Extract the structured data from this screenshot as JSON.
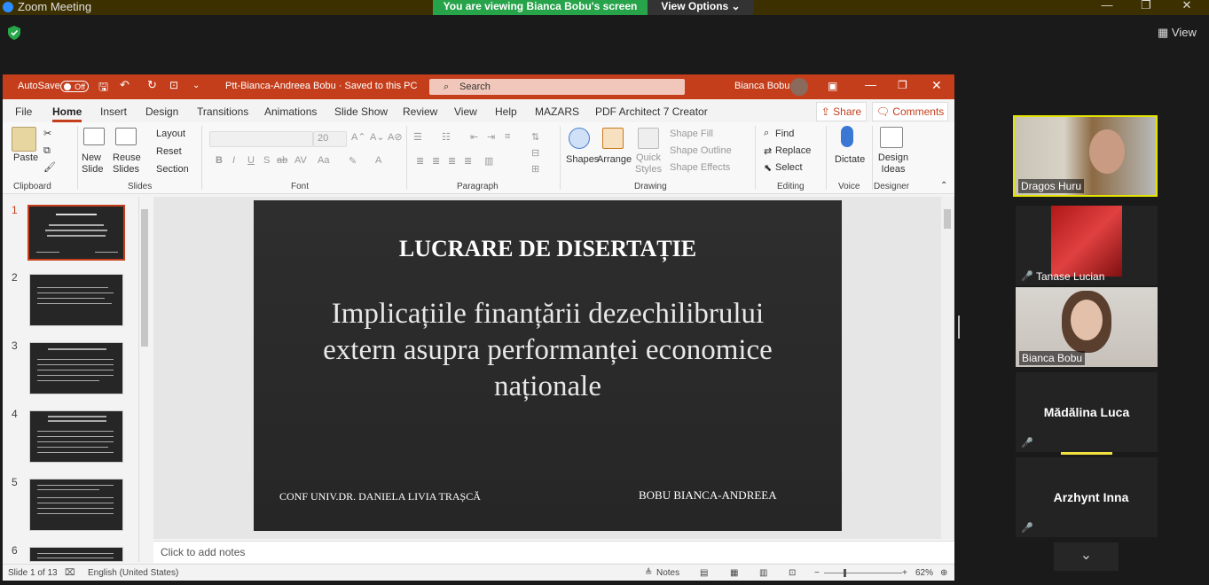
{
  "zoom": {
    "title": "Zoom Meeting",
    "share_banner": "You are viewing Bianca Bobu's screen",
    "view_options": "View Options ⌄",
    "minimize": "—",
    "maximize": "❐",
    "close": "✕",
    "view_label": "View",
    "accent_green": "#27a34a"
  },
  "ppt": {
    "autosave_label": "AutoSave",
    "autosave_state": "Off",
    "filename": "Ptt-Bianca-Andreea Bobu  ·  Saved to this PC",
    "search_placeholder": "Search",
    "user_name": "Bianca Bobu",
    "tabs": [
      "File",
      "Home",
      "Insert",
      "Design",
      "Transitions",
      "Animations",
      "Slide Show",
      "Review",
      "View",
      "Help",
      "MAZARS",
      "PDF Architect 7 Creator"
    ],
    "share_label": "Share",
    "comments_label": "Comments",
    "accent": "#c43e1c",
    "ribbon": {
      "clipboard": {
        "label": "Clipboard",
        "paste": "Paste"
      },
      "slides": {
        "label": "Slides",
        "new_slide": "New Slide",
        "reuse_slides": "Reuse Slides",
        "layout": "Layout",
        "reset": "Reset",
        "section": "Section"
      },
      "font": {
        "label": "Font",
        "font_size": "20"
      },
      "paragraph": {
        "label": "Paragraph"
      },
      "drawing": {
        "label": "Drawing",
        "shapes": "Shapes",
        "arrange": "Arrange",
        "quick_styles": "Quick Styles",
        "shape_fill": "Shape Fill",
        "shape_outline": "Shape Outline",
        "shape_effects": "Shape Effects"
      },
      "editing": {
        "label": "Editing",
        "find": "Find",
        "replace": "Replace",
        "select": "Select"
      },
      "voice": {
        "label": "Voice",
        "dictate": "Dictate"
      },
      "designer": {
        "label": "Designer",
        "design_ideas": "Design Ideas"
      }
    },
    "thumbnails": [
      "1",
      "2",
      "3",
      "4",
      "5",
      "6"
    ],
    "slide": {
      "title": "LUCRARE DE DISERTAȚIE",
      "subtitle": "Implicațiile finanțării dezechilibrului extern asupra performanței economice naționale",
      "author_left": "CONF UNIV.DR. DANIELA LIVIA TRAȘCĂ",
      "author_right": "BOBU BIANCA-ANDREEA"
    },
    "notes_placeholder": "Click to add notes",
    "status": {
      "slide_count": "Slide 1 of 13",
      "language": "English (United States)",
      "notes": "Notes",
      "zoom": "62%"
    }
  },
  "participants": [
    {
      "name": "Dragos Huru"
    },
    {
      "name": "Tanase Lucian"
    },
    {
      "name": "Bianca Bobu"
    },
    {
      "name": "Mădălina Luca"
    },
    {
      "name": "Arzhynt Inna"
    }
  ]
}
